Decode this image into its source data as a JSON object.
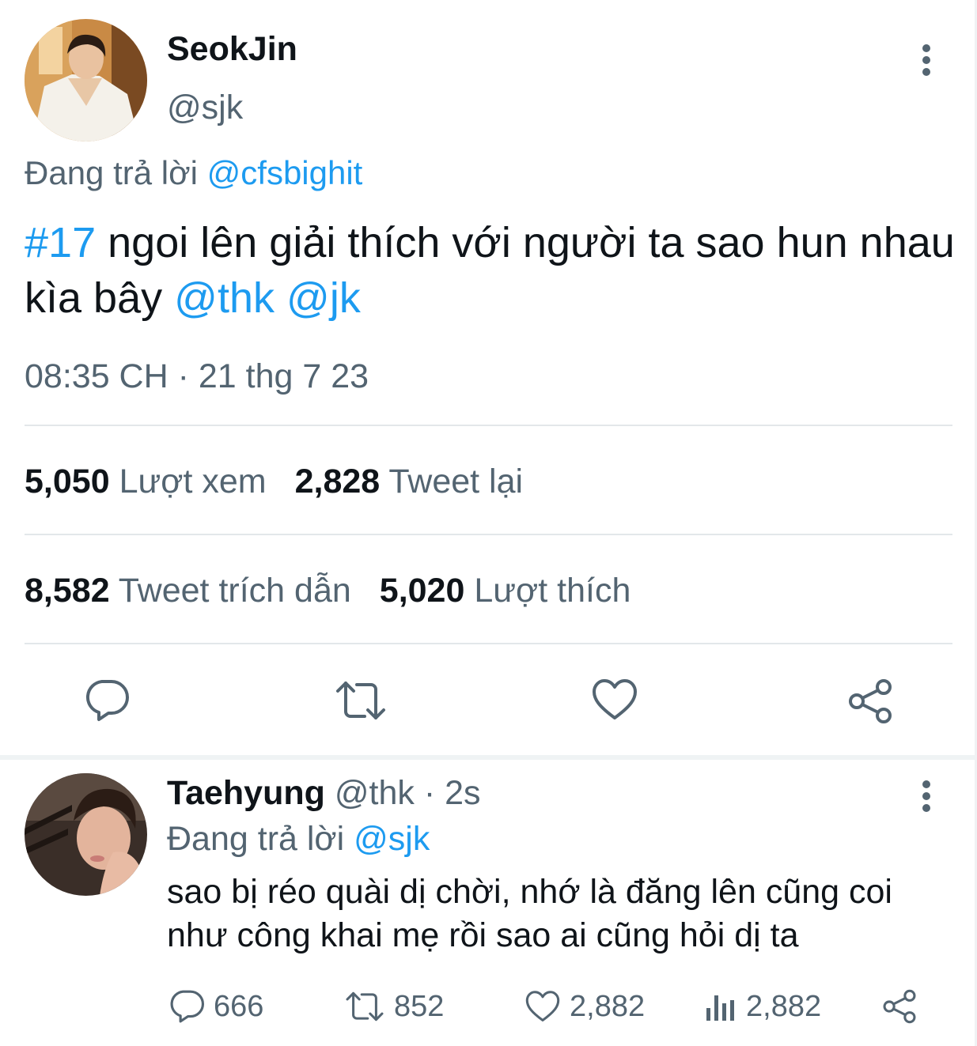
{
  "main_tweet": {
    "display_name": "SeokJin",
    "handle": "@sjk",
    "replying_prefix": "Đang trả lời",
    "replying_to": "@cfsbighit",
    "text": {
      "hashtag": "#17",
      "body": "ngoi lên giải thích với người ta sao hun nhau kìa bây",
      "mention_1": "@thk",
      "mention_2": "@jk"
    },
    "timestamp": "08:35 CH · 21 thg 7 23",
    "stats": {
      "views_count": "5,050",
      "views_label": "Lượt xem",
      "retweets_count": "2,828",
      "retweets_label": "Tweet lại",
      "quotes_count": "8,582",
      "quotes_label": "Tweet trích dẫn",
      "likes_count": "5,020",
      "likes_label": "Lượt thích"
    },
    "icons": [
      "more-vertical-icon",
      "reply-icon",
      "retweet-icon",
      "like-icon",
      "share-icon"
    ]
  },
  "reply_tweet": {
    "display_name": "Taehyung",
    "handle": "@thk",
    "time_ago": "· 2s",
    "replying_prefix": "Đang trả lời",
    "replying_to": "@sjk",
    "text": "sao bị réo quài dị chời, nhớ là đăng lên cũng coi như công khai mẹ rồi sao ai cũng hỏi dị ta",
    "actions": {
      "replies": "666",
      "retweets": "852",
      "likes": "2,882",
      "views": "2,882"
    },
    "icons": [
      "more-vertical-icon",
      "reply-icon",
      "retweet-icon",
      "like-icon",
      "views-icon",
      "share-icon"
    ]
  },
  "colors": {
    "link": "#1d9bf0",
    "secondary_text": "#536471",
    "primary_text": "#0f1419",
    "divider": "#e3e7ea"
  }
}
